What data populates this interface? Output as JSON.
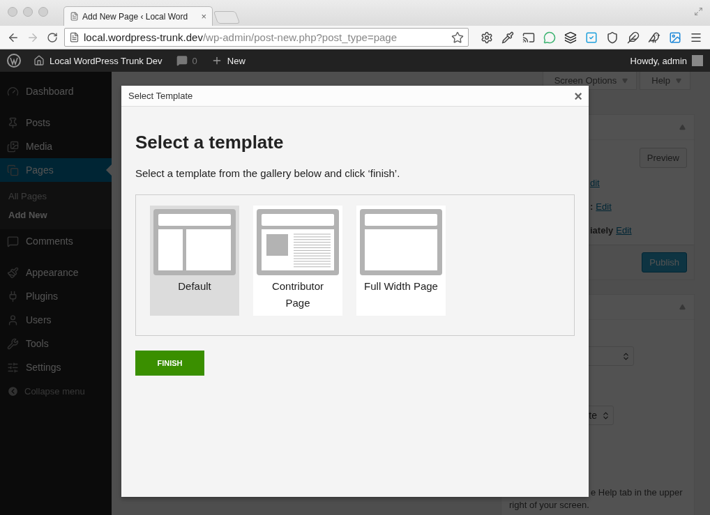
{
  "browser": {
    "tab": {
      "title": "Add New Page ‹ Local Word",
      "close": "×"
    },
    "url": {
      "host": "local.wordpress-trunk.dev",
      "path": "/wp-admin/post-new.php?post_type=page"
    }
  },
  "admin_bar": {
    "site": "Local WordPress Trunk Dev",
    "comments": "0",
    "new": "New",
    "account": "Howdy, admin"
  },
  "sidebar": {
    "groups": [
      [
        {
          "label": "Dashboard",
          "selected": false
        }
      ],
      [
        {
          "label": "Posts",
          "selected": false
        },
        {
          "label": "Media",
          "selected": false
        },
        {
          "label": "Pages",
          "selected": true,
          "children": [
            {
              "label": "All Pages",
              "selected": false
            },
            {
              "label": "Add New",
              "selected": true
            }
          ]
        },
        {
          "label": "Comments",
          "selected": false
        }
      ],
      [
        {
          "label": "Appearance",
          "selected": false
        },
        {
          "label": "Plugins",
          "selected": false
        },
        {
          "label": "Users",
          "selected": false
        },
        {
          "label": "Tools",
          "selected": false
        },
        {
          "label": "Settings",
          "selected": false
        }
      ]
    ],
    "collapse": "Collapse menu"
  },
  "screen_meta": [
    "Screen Options",
    "Help"
  ],
  "publish_box": {
    "preview": "Preview",
    "rows": [
      {
        "link": "dit"
      },
      {
        "text": ":",
        "link": "Edit"
      },
      {
        "text": "iately",
        "link": "Edit"
      }
    ],
    "publish": "Publish"
  },
  "attributes_box": {
    "fields": [
      {
        "kind": "select"
      },
      {
        "kind": "select",
        "value": "te"
      }
    ],
    "help": [
      "e Help tab in the upper",
      "right of your screen."
    ]
  },
  "modal": {
    "title": "Select Template",
    "close": "×",
    "heading": "Select a template",
    "description": "Select a template from the gallery below and click ‘finish’.",
    "templates": [
      {
        "label": "Default",
        "kind": "sidebar",
        "selected": true
      },
      {
        "label": "Contributor Page",
        "kind": "contributor",
        "selected": false
      },
      {
        "label": "Full Width Page",
        "kind": "full-width",
        "selected": false
      }
    ],
    "finish": "FINISH"
  }
}
